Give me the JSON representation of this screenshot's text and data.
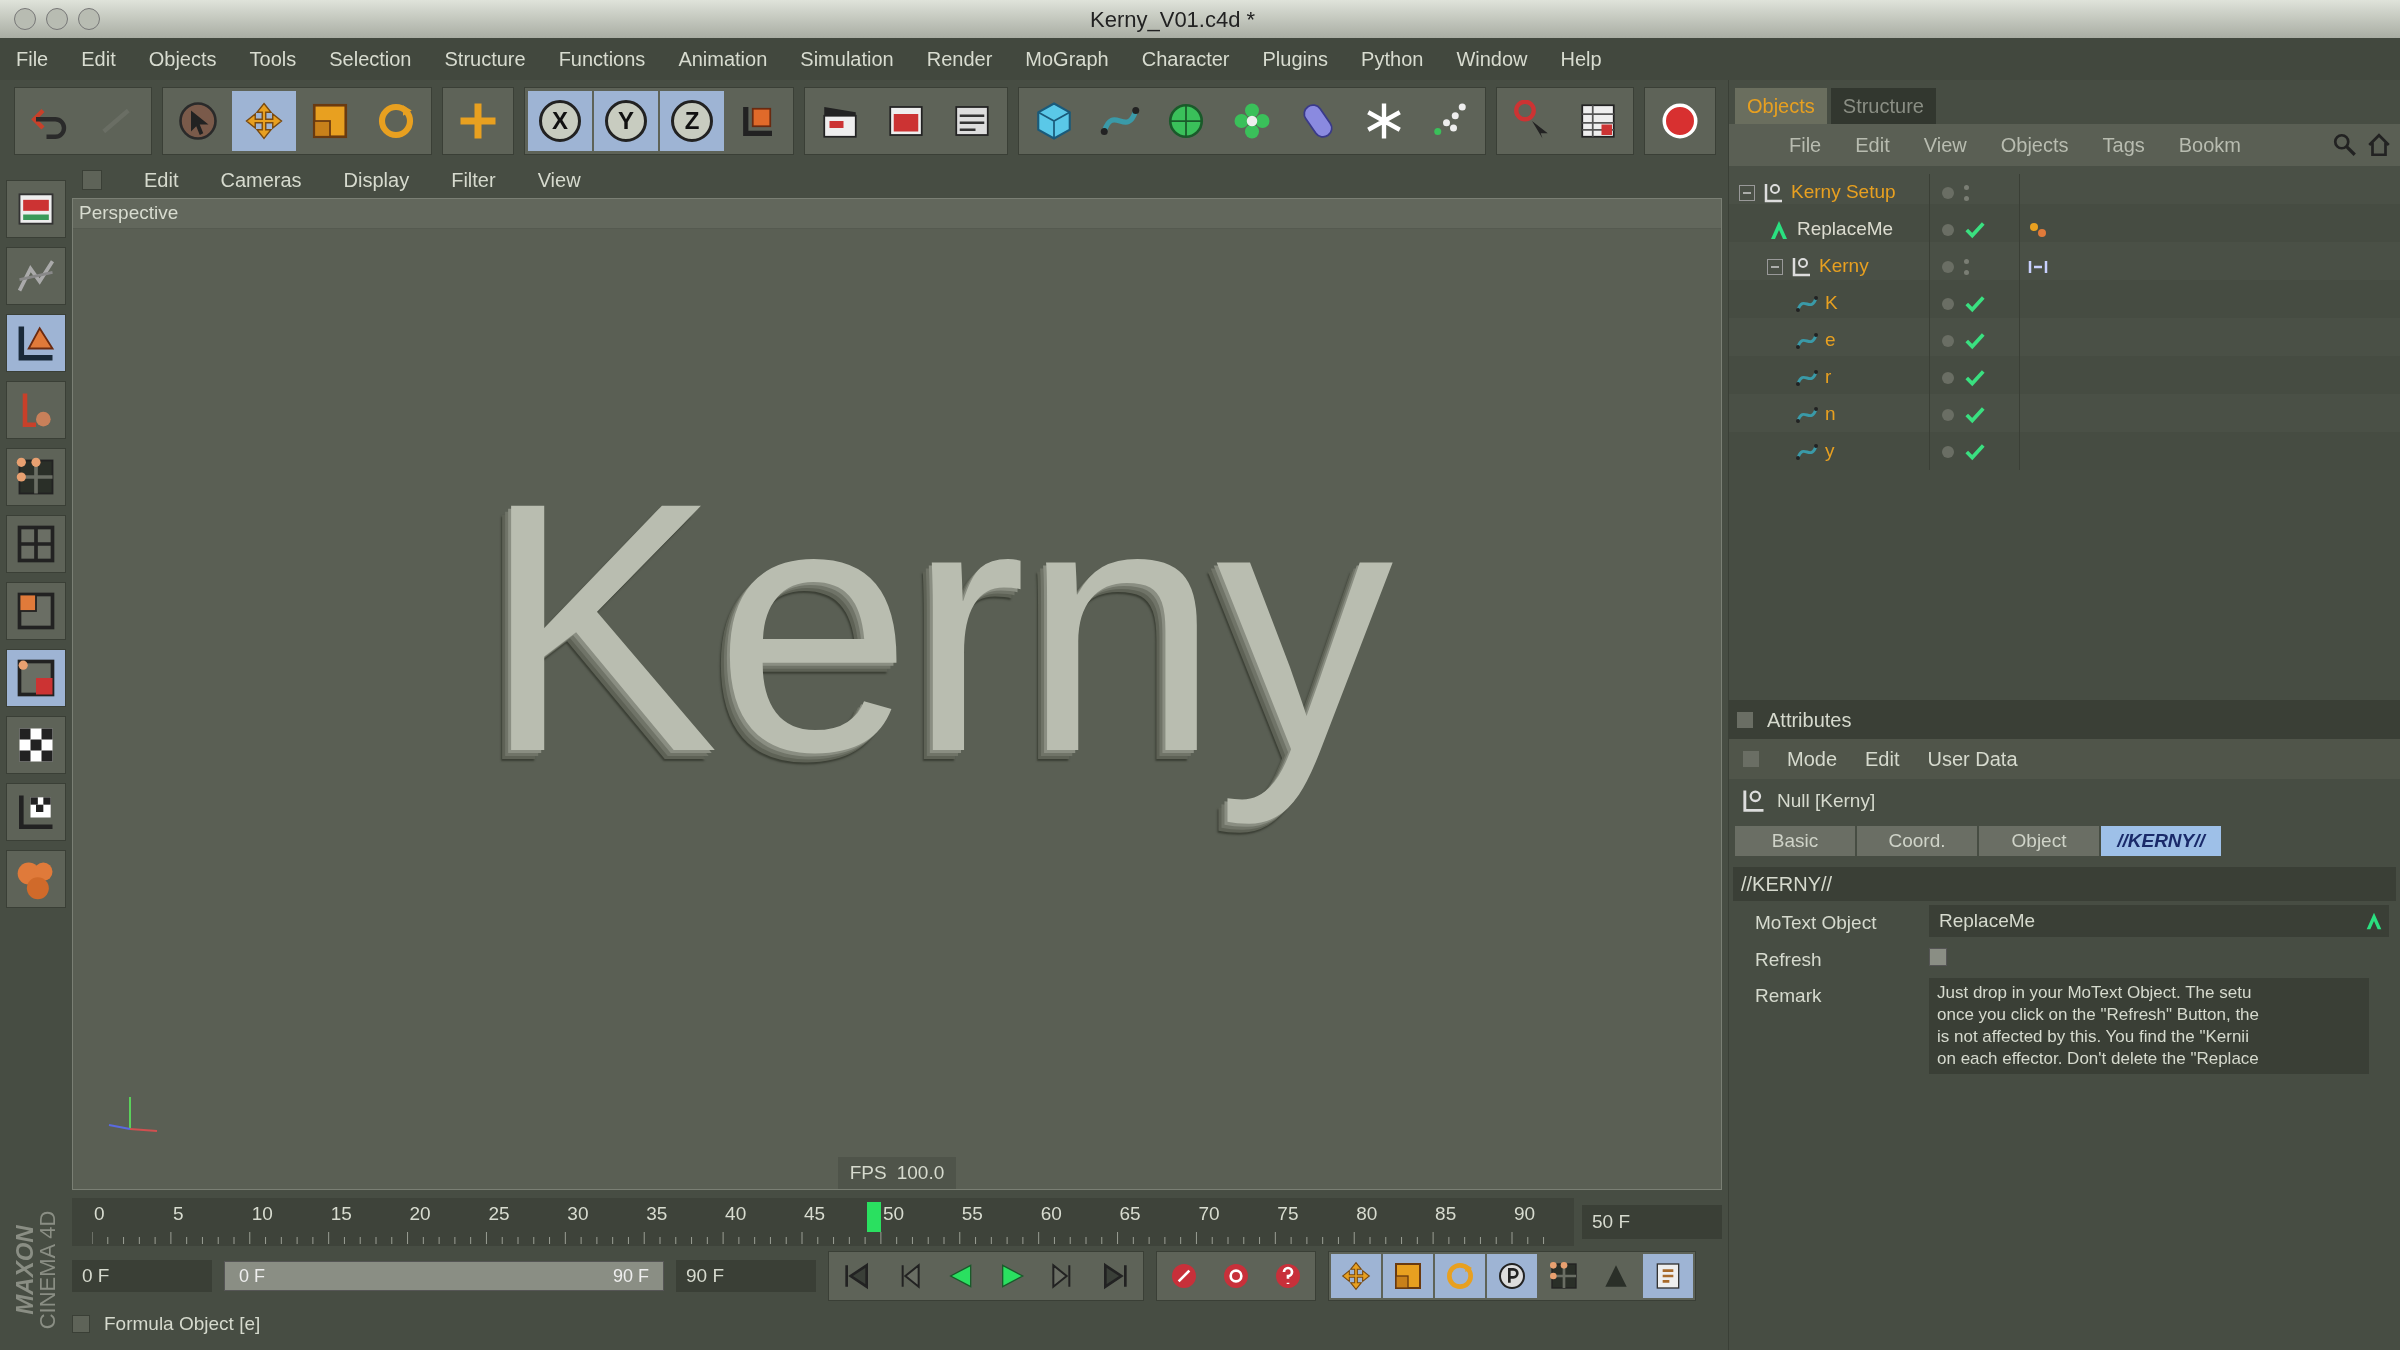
{
  "window": {
    "title": "Kerny_V01.c4d *"
  },
  "menu": [
    "File",
    "Edit",
    "Objects",
    "Tools",
    "Selection",
    "Structure",
    "Functions",
    "Animation",
    "Simulation",
    "Render",
    "MoGraph",
    "Character",
    "Plugins",
    "Python",
    "Window",
    "Help"
  ],
  "toolbar": [
    [
      {
        "kind": "undo",
        "selected": false
      },
      {
        "kind": "redo",
        "selected": false
      }
    ],
    [
      {
        "kind": "pointer",
        "selected": false
      },
      {
        "kind": "move",
        "selected": true
      },
      {
        "kind": "scale",
        "selected": false
      },
      {
        "kind": "rotate",
        "selected": false
      }
    ],
    [
      {
        "kind": "plus",
        "selected": false
      }
    ],
    [
      {
        "kind": "axis",
        "label": "X",
        "selected": true
      },
      {
        "kind": "axis",
        "label": "Y",
        "selected": true
      },
      {
        "kind": "axis",
        "label": "Z",
        "selected": true
      },
      {
        "kind": "coords",
        "selected": false
      }
    ],
    [
      {
        "kind": "clapper",
        "selected": false
      },
      {
        "kind": "render-window",
        "selected": false
      },
      {
        "kind": "render-settings",
        "selected": false
      }
    ],
    [
      {
        "kind": "cube",
        "selected": false
      },
      {
        "kind": "spline",
        "selected": false
      },
      {
        "kind": "sphere",
        "selected": false
      },
      {
        "kind": "flower",
        "selected": false
      },
      {
        "kind": "capsule",
        "selected": false
      },
      {
        "kind": "snowflake",
        "selected": false
      },
      {
        "kind": "dots",
        "selected": false
      }
    ],
    [
      {
        "kind": "help",
        "selected": false
      },
      {
        "kind": "table",
        "selected": false
      }
    ],
    [
      {
        "kind": "record",
        "selected": false
      }
    ]
  ],
  "left_tools": [
    {
      "kind": "layout",
      "selected": false
    },
    {
      "kind": "texture",
      "selected": false
    },
    {
      "kind": "model",
      "selected": true
    },
    {
      "kind": "object-axis",
      "selected": false
    },
    {
      "kind": "points",
      "selected": false
    },
    {
      "kind": "edges",
      "selected": false
    },
    {
      "kind": "polygons",
      "selected": false
    },
    {
      "kind": "uvw",
      "selected": true
    },
    {
      "kind": "checker",
      "selected": false
    },
    {
      "kind": "checker-axis",
      "selected": false
    },
    {
      "kind": "blobs",
      "selected": false
    }
  ],
  "viewport": {
    "menu": [
      "Edit",
      "Cameras",
      "Display",
      "Filter",
      "View"
    ],
    "label": "Perspective",
    "scene_text": "Kerny",
    "fps_label": "FPS",
    "fps_value": "100.0"
  },
  "timeline": {
    "ticks": [
      "0",
      "5",
      "10",
      "15",
      "20",
      "25",
      "30",
      "35",
      "40",
      "45",
      "50",
      "55",
      "60",
      "65",
      "70",
      "75",
      "80",
      "85",
      "90"
    ],
    "playhead": {
      "level": 0.5556
    },
    "current_field": "50 F",
    "start_field": "0 F",
    "range": {
      "start": "0 F",
      "end": "90 F",
      "level": 1
    },
    "end_field": "90 F"
  },
  "transport": [
    {
      "kind": "first"
    },
    {
      "kind": "prev-key"
    },
    {
      "kind": "play-back"
    },
    {
      "kind": "play"
    },
    {
      "kind": "next-key"
    },
    {
      "kind": "last"
    }
  ],
  "record_tools": [
    {
      "kind": "record-key"
    },
    {
      "kind": "auto-key"
    },
    {
      "kind": "question"
    }
  ],
  "key_tools": [
    {
      "kind": "move",
      "selected": true
    },
    {
      "kind": "scale",
      "selected": true
    },
    {
      "kind": "rotate",
      "selected": true
    },
    {
      "kind": "param",
      "selected": true
    },
    {
      "kind": "points",
      "selected": false
    },
    {
      "kind": "pla",
      "selected": false
    },
    {
      "kind": "scheme",
      "selected": true
    }
  ],
  "logo": [
    "MAXON",
    "CINEMA 4D"
  ],
  "status_bar": "Formula Object [e]",
  "objects": {
    "tabs": [
      {
        "label": "Objects",
        "selected": true
      },
      {
        "label": "Structure",
        "selected": false
      }
    ],
    "menu": [
      "File",
      "Edit",
      "View",
      "Objects",
      "Tags",
      "Bookm"
    ],
    "tree": [
      {
        "name": "Kerny Setup",
        "kind": "null",
        "selected": true,
        "enabled": false,
        "expanded": true,
        "children": [
          {
            "name": "ReplaceMe",
            "kind": "motext",
            "selected": false,
            "enabled": true,
            "tags": [
              {
                "kind": "script"
              }
            ]
          },
          {
            "name": "Kerny",
            "kind": "null",
            "selected": true,
            "enabled": false,
            "expanded": true,
            "tags": [
              {
                "kind": "link"
              }
            ],
            "children": [
              {
                "name": "K",
                "kind": "spline",
                "selected": true,
                "enabled": true
              },
              {
                "name": "e",
                "kind": "spline",
                "selected": true,
                "enabled": true
              },
              {
                "name": "r",
                "kind": "spline",
                "selected": true,
                "enabled": true
              },
              {
                "name": "n",
                "kind": "spline",
                "selected": true,
                "enabled": true
              },
              {
                "name": "y",
                "kind": "spline",
                "selected": true,
                "enabled": true
              }
            ]
          }
        ]
      }
    ]
  },
  "attributes": {
    "title": "Attributes",
    "menu": [
      "Mode",
      "Edit",
      "User Data"
    ],
    "object": "Null [Kerny]",
    "tabs": [
      {
        "label": "Basic",
        "selected": false
      },
      {
        "label": "Coord.",
        "selected": false
      },
      {
        "label": "Object",
        "selected": false
      },
      {
        "label": "//KERNY//",
        "selected": true
      }
    ],
    "section": "//KERNY//",
    "fields": [
      {
        "kind": "link",
        "label": "MoText Object",
        "value": "ReplaceMe"
      },
      {
        "kind": "button",
        "label": "Refresh"
      },
      {
        "kind": "text",
        "label": "Remark",
        "lines": [
          "Just drop in your MoText Object. The setu",
          "once you click on the \"Refresh\" Button, the",
          "is not affected by this. You find the \"Kernii",
          "on each effector. Don't delete the \"Replace"
        ]
      }
    ]
  }
}
